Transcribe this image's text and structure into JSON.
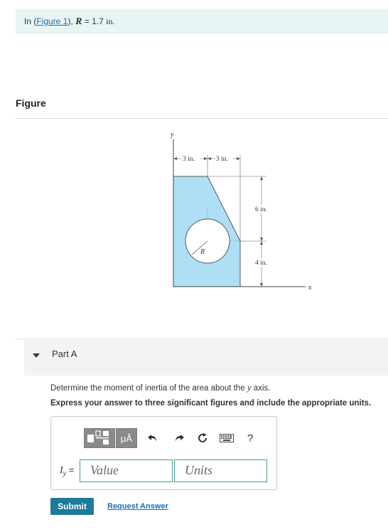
{
  "problem": {
    "prefix": "In (",
    "figure_link": "Figure 1",
    "suffix": "),",
    "var": "R",
    "equals": "= 1.7",
    "unit": "in."
  },
  "figure": {
    "heading": "Figure",
    "labels": {
      "y_axis": "y",
      "x_axis": "x",
      "dim_top_left": "3 in.",
      "dim_top_right": "3 in.",
      "dim_right_upper": "6 in.",
      "dim_right_lower": "4 in.",
      "radius": "R"
    },
    "colors": {
      "shape_fill": "#aee0f5",
      "shape_stroke": "#444444"
    }
  },
  "part_a": {
    "title": "Part A",
    "question_prefix": "Determine the moment of inertia of the area about the",
    "question_var": "y",
    "question_suffix": "axis.",
    "instruction": "Express your answer to three significant figures and include the appropriate units.",
    "toolbar": {
      "template_icon": "template-icon",
      "units_icon_label": "μÅ",
      "undo_icon": "undo-icon",
      "redo_icon": "redo-icon",
      "reset_icon": "reset-icon",
      "keyboard_icon": "keyboard-icon",
      "help_label": "?"
    },
    "answer_label_var": "I",
    "answer_label_sub": "y",
    "answer_label_eq": "=",
    "value_placeholder": "Value",
    "units_placeholder": "Units",
    "submit_label": "Submit",
    "request_label": "Request Answer"
  }
}
